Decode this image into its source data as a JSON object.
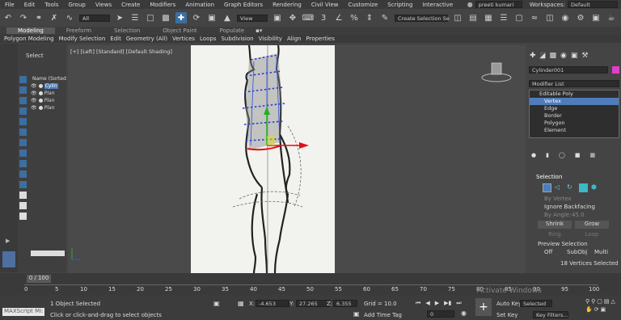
{
  "menu": {
    "items": [
      "File",
      "Edit",
      "Tools",
      "Group",
      "Views",
      "Create",
      "Modifiers",
      "Animation",
      "Graph Editors",
      "Rendering",
      "Civil View",
      "Customize",
      "Scripting",
      "Interactive"
    ],
    "user_name": "preeti kumari",
    "workspaces_label": "Workspaces:",
    "workspace_value": "Default"
  },
  "toolbar": {
    "filter_value": "All",
    "coord_value": "View",
    "selection_set_value": "Create Selection Se"
  },
  "ribbon": {
    "tabs": [
      "Modeling",
      "Freeform",
      "Selection",
      "Object Paint",
      "Populate"
    ],
    "active_tab": "Modeling",
    "items": [
      "Polygon Modeling",
      "Modify Selection",
      "Edit",
      "Geometry (All)",
      "Vertices",
      "Loops",
      "Subdivision",
      "Visibility",
      "Align",
      "Properties"
    ]
  },
  "scene_explorer": {
    "select_label": "Select",
    "name_header": "Name (Sorted A",
    "rows": [
      "Cylin",
      "Plan",
      "Plan",
      "Plan"
    ]
  },
  "viewport": {
    "label": "[+] [Left] [Standard] [Default Shading]"
  },
  "command_panel": {
    "object_name": "Cylinder001",
    "modifier_list_label": "Modifier List",
    "stack": [
      "Editable Poly",
      "Vertex",
      "Edge",
      "Border",
      "Polygon",
      "Element"
    ],
    "selection_header": "Selection",
    "by_vertex": "By Vertex",
    "ignore_backfacing": "Ignore Backfacing",
    "by_angle_label": "By Angle:",
    "by_angle_value": "45.0",
    "shrink": "Shrink",
    "grow": "Grow",
    "ring": "Ring",
    "loop": "Loop",
    "preview_selection": "Preview Selection",
    "preview_options": [
      "Off",
      "SubObj",
      "Multi"
    ],
    "selected_count": "18 Vertices Selected",
    "accent_color": "#e040c8"
  },
  "timeline": {
    "frame_display": "0 / 100",
    "ticks": [
      "0",
      "5",
      "10",
      "15",
      "20",
      "25",
      "30",
      "35",
      "40",
      "45",
      "50",
      "55",
      "60",
      "65",
      "70",
      "75",
      "80",
      "85",
      "90",
      "95",
      "100"
    ]
  },
  "status": {
    "maxscript_label": "MAXScript Mi:",
    "objects_selected": "1 Object Selected",
    "prompt": "Click or click-and-drag to select objects",
    "x_label": "X:",
    "x_value": "-4.653",
    "y_label": "Y:",
    "y_value": "27.265",
    "z_label": "Z:",
    "z_value": "6.355",
    "grid": "Grid = 10.0",
    "add_time_tag": "Add Time Tag",
    "auto_key": "Auto Key",
    "selected_dropdown": "Selected",
    "set_key": "Set Key",
    "key_filters": "Key Filters...",
    "frame_field": "0",
    "watermark": "Activate Windows"
  }
}
